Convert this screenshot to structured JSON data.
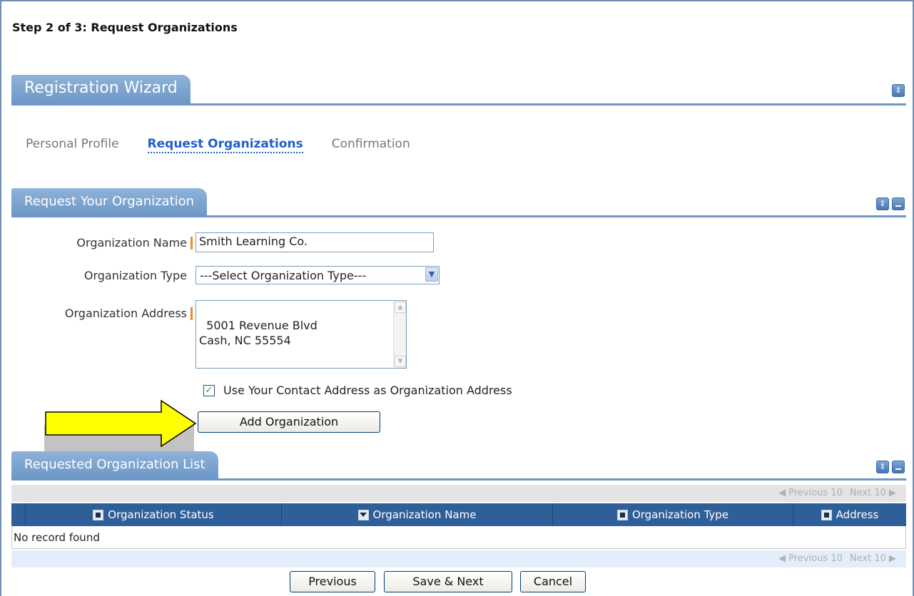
{
  "step_title": "Step 2 of 3: Request Organizations",
  "wizard": {
    "title": "Registration Wizard",
    "steps": [
      {
        "label": "Personal Profile",
        "active": false
      },
      {
        "label": "Request Organizations",
        "active": true
      },
      {
        "label": "Confirmation",
        "active": false
      }
    ]
  },
  "request_section": {
    "title": "Request Your Organization",
    "org_name": {
      "label": "Organization Name",
      "value": "Smith Learning Co."
    },
    "org_type": {
      "label": "Organization Type",
      "selected": "---Select Organization Type---"
    },
    "org_address": {
      "label": "Organization Address",
      "value": "5001 Revenue Blvd\nCash, NC 55554"
    },
    "use_contact": {
      "label": "Use Your Contact Address as Organization Address",
      "checked": true
    },
    "add_button": "Add Organization"
  },
  "list_section": {
    "title": "Requested Organization List",
    "pager": {
      "previous": "Previous 10",
      "next": "Next 10"
    },
    "columns": [
      "Organization Status",
      "Organization Name",
      "Organization Type",
      "Address"
    ],
    "empty_text": "No record found"
  },
  "footer": {
    "previous": "Previous",
    "save_next": "Save & Next",
    "cancel": "Cancel"
  },
  "colors": {
    "accent": "#6d97c6",
    "grid_header": "#2f5f99",
    "required": "#f08a2a",
    "arrow": "#ffff00"
  }
}
